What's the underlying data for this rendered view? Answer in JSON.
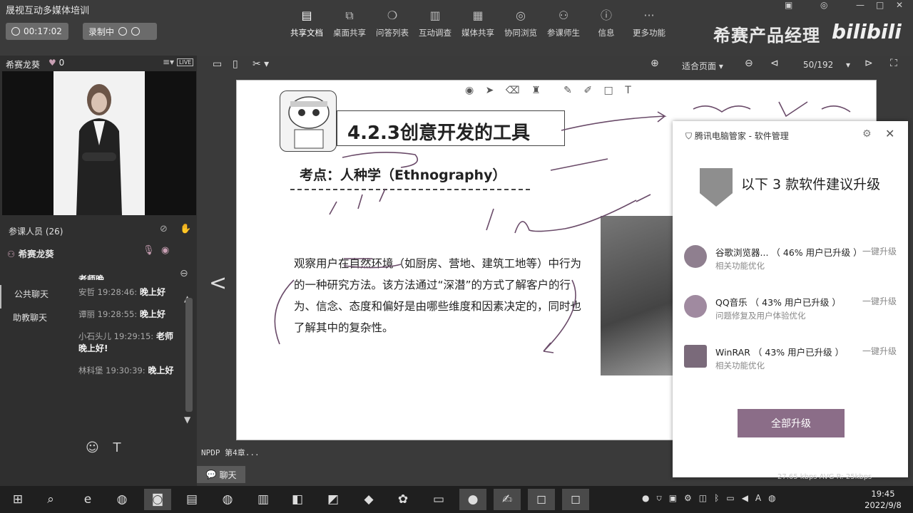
{
  "app": {
    "title": "晟视互动多媒体培训",
    "timer": "00:17:02",
    "recording_label": "录制中",
    "brand": "希赛产品经理",
    "bilibili": "bilibili"
  },
  "toolbar": [
    {
      "label": "共享文档",
      "icon": "document-icon",
      "active": true
    },
    {
      "label": "桌面共享",
      "icon": "screen-share-icon",
      "active": false
    },
    {
      "label": "问答列表",
      "icon": "qa-icon",
      "active": false
    },
    {
      "label": "互动调查",
      "icon": "survey-icon",
      "active": false
    },
    {
      "label": "媒体共享",
      "icon": "media-icon",
      "active": false
    },
    {
      "label": "协同浏览",
      "icon": "browse-icon",
      "active": false
    },
    {
      "label": "参课师生",
      "icon": "people-icon",
      "active": false
    },
    {
      "label": "信息",
      "icon": "info-icon",
      "active": false
    },
    {
      "label": "更多功能",
      "icon": "more-icon",
      "active": false
    }
  ],
  "left": {
    "teacher": "希赛龙葵",
    "likes": "0",
    "live_badge": "LIVE",
    "participants_label": "参课人员 (26)",
    "host_name": "希赛龙葵",
    "tabs": [
      "公共聊天",
      "助教聊天"
    ],
    "partial_text": "老师晚",
    "messages": [
      {
        "who": "安哲 19:28:46:",
        "text": "晚上好"
      },
      {
        "who": "谭丽 19:28:55:",
        "text": "晚上好"
      },
      {
        "who": "小石头儿 19:29:15:",
        "text": "老师晚上好!"
      },
      {
        "who": "林科堡 19:30:39:",
        "text": "晚上好"
      }
    ],
    "emoji_icon": "☺",
    "text_icon": "T"
  },
  "viewer": {
    "fit_label": "适合页面",
    "page": "50/192",
    "doc_name": "NPDP 第4章...",
    "chat_button": "聊天"
  },
  "slide": {
    "title": "4.2.3创意开发的工具",
    "key_point": "考点：人种学（Ethnography）",
    "body": "观察用户在自然环境（如厨房、营地、建筑工地等）中行为的一种研究方法。该方法通过“深潜”的方式了解客户的行为、信念、态度和偏好是由哪些维度和因素决定的，同时也了解其中的复杂性。"
  },
  "popup": {
    "header": "腾讯电脑管家 - 软件管理",
    "title": "以下 3 款软件建议升级",
    "items": [
      {
        "name": "谷歌浏览器...",
        "stat": "（ 46% 用户已升级 ）",
        "sub": "相关功能优化",
        "action": "一键升级"
      },
      {
        "name": "QQ音乐",
        "stat": "（ 43% 用户已升级 ）",
        "sub": "问题修复及用户体验优化",
        "action": "一键升级"
      },
      {
        "name": "WinRAR",
        "stat": "（ 43% 用户已升级 ）",
        "sub": "相关功能优化",
        "action": "一键升级"
      }
    ],
    "upgrade_all": "全部升级"
  },
  "status": {
    "net_speed": "27.65 kbps   AVG R: 25kbps"
  },
  "taskbar": {
    "time": "19:45",
    "date": "2022/9/8",
    "lang": "A"
  }
}
